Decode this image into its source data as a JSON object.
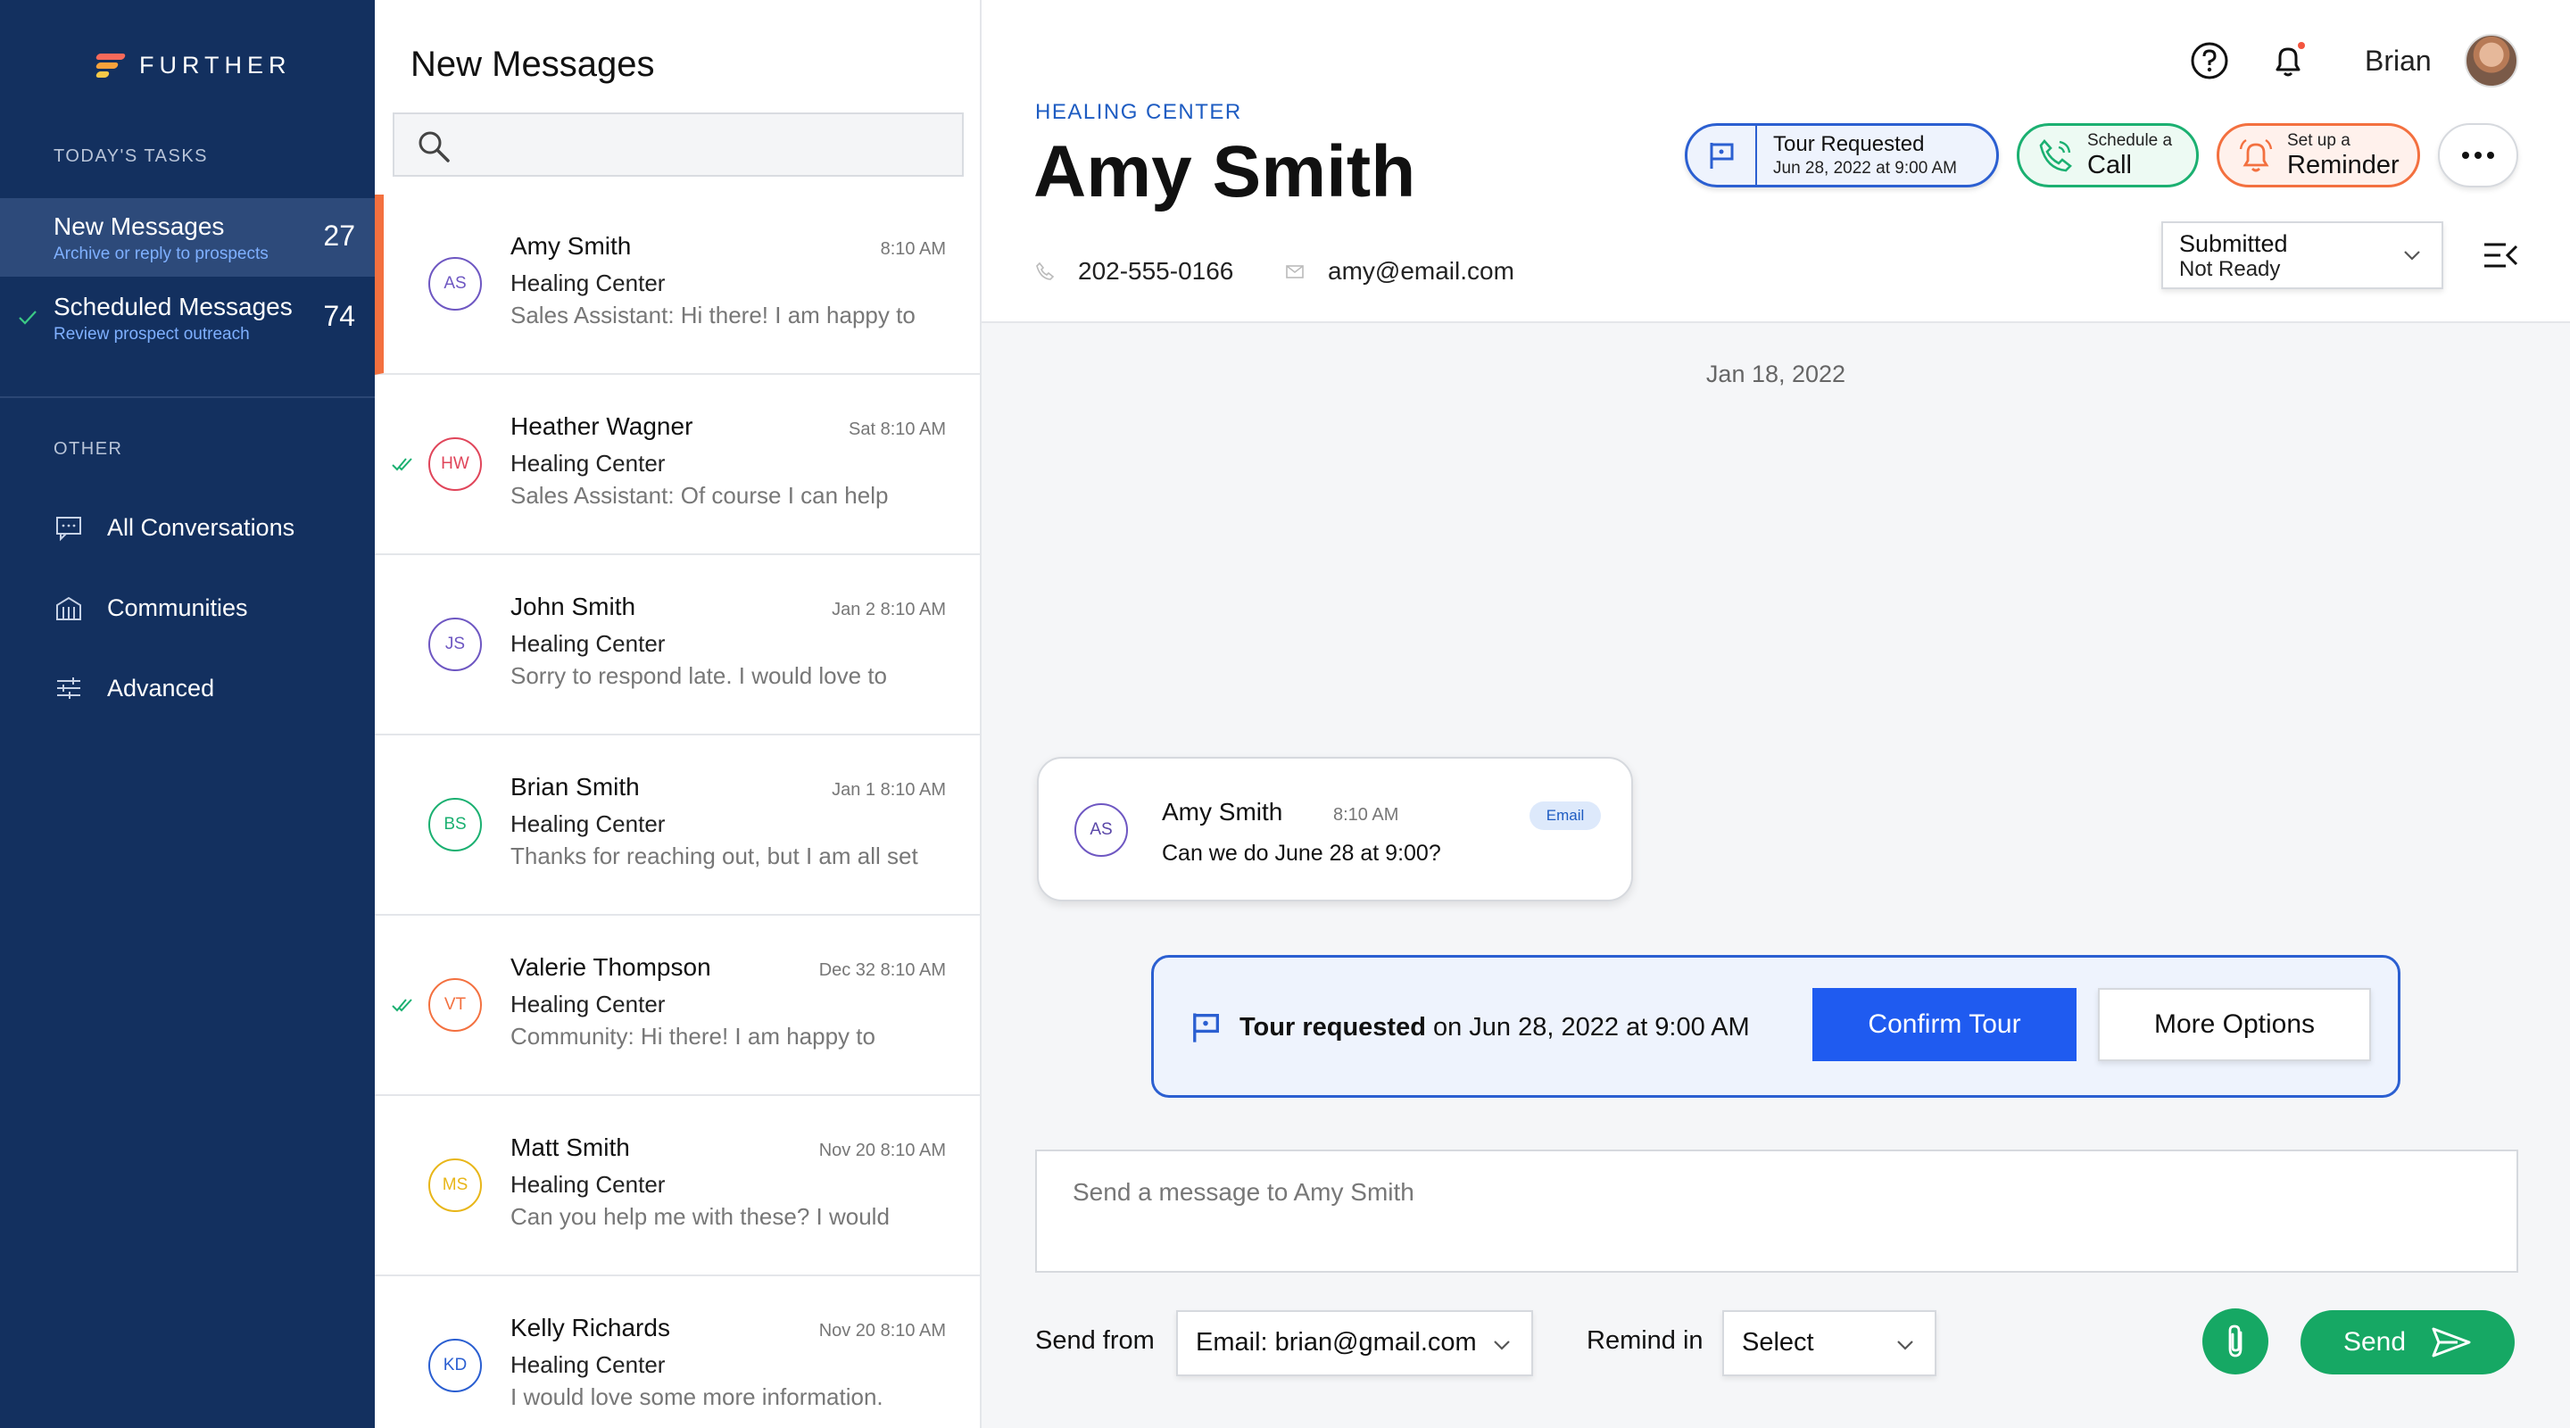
{
  "sidebar": {
    "brand": "FURTHER",
    "todays_tasks_label": "TODAY'S TASKS",
    "tasks": [
      {
        "title": "New Messages",
        "subtitle": "Archive or reply to prospects",
        "count": "27"
      },
      {
        "title": "Scheduled Messages",
        "subtitle": "Review prospect outreach",
        "count": "74"
      }
    ],
    "other_label": "OTHER",
    "nav": [
      {
        "label": "All Conversations",
        "icon": "chat-icon"
      },
      {
        "label": "Communities",
        "icon": "building-icon"
      },
      {
        "label": "Advanced",
        "icon": "sliders-icon"
      }
    ]
  },
  "list": {
    "title": "New Messages",
    "search_placeholder": "",
    "items": [
      {
        "initials": "AS",
        "name": "Amy Smith",
        "time": "8:10 AM",
        "org": "Healing Center",
        "preview": "Sales Assistant: Hi there! I am happy to",
        "color": "#6e57c2",
        "checked": false
      },
      {
        "initials": "HW",
        "name": "Heather Wagner",
        "time": "Sat 8:10 AM",
        "org": "Healing Center",
        "preview": "Sales Assistant: Of course I can help",
        "color": "#e0455a",
        "checked": true
      },
      {
        "initials": "JS",
        "name": "John Smith",
        "time": "Jan 2 8:10 AM",
        "org": "Healing Center",
        "preview": "Sorry to respond late. I would love to",
        "color": "#6e57c2",
        "checked": false
      },
      {
        "initials": "BS",
        "name": "Brian Smith",
        "time": "Jan 1 8:10 AM",
        "org": "Healing Center",
        "preview": "Thanks for reaching out, but I am all set",
        "color": "#1bb071",
        "checked": false
      },
      {
        "initials": "VT",
        "name": "Valerie Thompson",
        "time": "Dec 32 8:10 AM",
        "org": "Healing Center",
        "preview": "Community: Hi there! I am happy to",
        "color": "#f3703f",
        "checked": true
      },
      {
        "initials": "MS",
        "name": "Matt Smith",
        "time": "Nov 20 8:10 AM",
        "org": "Healing Center",
        "preview": "Can you help me with these? I would",
        "color": "#e8b619",
        "checked": false
      },
      {
        "initials": "KD",
        "name": "Kelly Richards",
        "time": "Nov 20 8:10 AM",
        "org": "Healing Center",
        "preview": "I would love some more information.",
        "color": "#2b5fd1",
        "checked": false
      }
    ]
  },
  "header": {
    "user_name": "Brian",
    "org": "HEALING CENTER",
    "contact_name": "Amy Smith",
    "phone": "202-555-0166",
    "email": "amy@email.com",
    "tour_pill": {
      "title": "Tour Requested",
      "date": "Jun 28, 2022 at 9:00 AM"
    },
    "call_pill": {
      "small": "Schedule a",
      "big": "Call"
    },
    "reminder_pill": {
      "small": "Set up a",
      "big": "Reminder"
    },
    "status": {
      "line1": "Submitted",
      "line2": "Not Ready"
    }
  },
  "conversation": {
    "date": "Jan 18, 2022",
    "message": {
      "initials": "AS",
      "name": "Amy Smith",
      "time": "8:10 AM",
      "tag": "Email",
      "text": "Can we do June 28 at 9:00?"
    },
    "tour_card": {
      "bold": "Tour requested",
      "rest": " on Jun 28, 2022 at 9:00 AM",
      "confirm_label": "Confirm Tour",
      "more_label": "More Options"
    },
    "composer": {
      "placeholder": "Send a message to Amy Smith",
      "send_from_label": "Send from",
      "send_from_value": "Email: brian@gmail.com",
      "remind_label": "Remind in",
      "remind_value": "Select",
      "send_label": "Send"
    }
  },
  "colors": {
    "sidebar": "#13305f",
    "accent_orange": "#f3703f",
    "primary_blue": "#1f5bf0",
    "green": "#16a864"
  }
}
